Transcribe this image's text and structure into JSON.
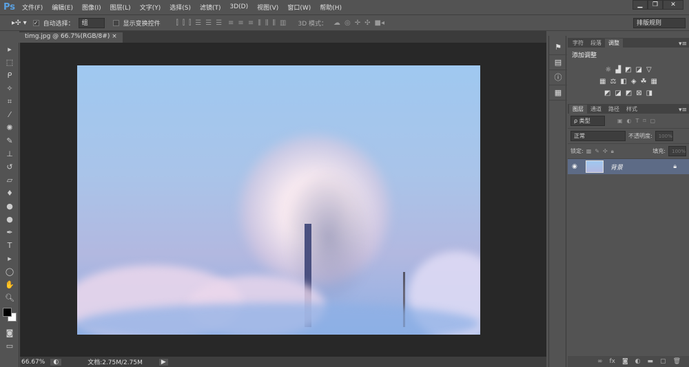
{
  "app": {
    "logo": "Ps"
  },
  "menu": [
    "文件(F)",
    "编辑(E)",
    "图像(I)",
    "图层(L)",
    "文字(Y)",
    "选择(S)",
    "滤镜(T)",
    "3D(D)",
    "视图(V)",
    "窗口(W)",
    "帮助(H)"
  ],
  "window_controls": {
    "minimize": "▁",
    "restore": "❐",
    "close": "✕"
  },
  "options": {
    "auto_select_label": "自动选择：",
    "auto_select_checked": true,
    "auto_select_value": "组",
    "show_transform_label": "显示变换控件",
    "show_transform_checked": false,
    "mode3d_label": "3D 模式：",
    "workspace": "排版规则"
  },
  "document_tab": {
    "title": "timg.jpg @ 66.7%(RGB/8#)",
    "close": "×"
  },
  "status": {
    "zoom": "66.67%",
    "doc": "文档:2.75M/2.75M"
  },
  "adjust_panel": {
    "tabs": [
      "字符",
      "段落",
      "调整"
    ],
    "active": 2,
    "title": "添加调整"
  },
  "layers_panel": {
    "tabs": [
      "图层",
      "通道",
      "路径",
      "样式"
    ],
    "active": 0,
    "filter": "ρ 类型",
    "blend_mode": "正常",
    "opacity_label": "不透明度:",
    "opacity": "100%",
    "lock_label": "锁定:",
    "fill_label": "填充:",
    "fill": "100%",
    "layers": [
      {
        "name": "背景",
        "visible": true,
        "locked": true
      }
    ]
  },
  "colors": {
    "foreground": "#000000",
    "background": "#ffffff",
    "accent": "#5aa0e0"
  }
}
